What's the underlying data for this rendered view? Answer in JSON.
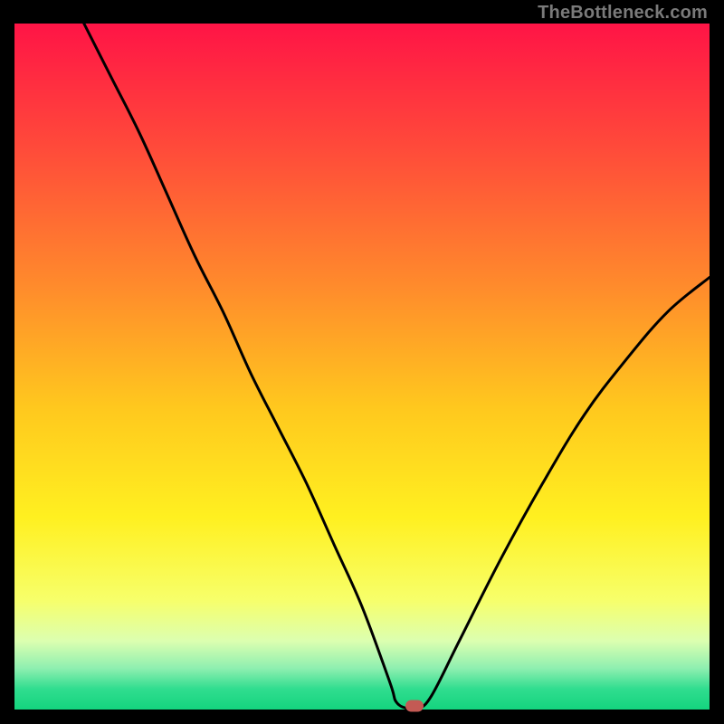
{
  "watermark": "TheBottleneck.com",
  "chart_data": {
    "type": "line",
    "title": "",
    "xlabel": "",
    "ylabel": "",
    "xlim": [
      0,
      100
    ],
    "ylim": [
      0,
      100
    ],
    "grid": false,
    "legend": false,
    "series": [
      {
        "name": "bottleneck-curve",
        "x": [
          10,
          14,
          18,
          22,
          26,
          30,
          34,
          38,
          42,
          46,
          50,
          54,
          55,
          57,
          58,
          60,
          64,
          70,
          76,
          82,
          88,
          94,
          100
        ],
        "y": [
          100,
          92,
          84,
          75,
          66,
          58,
          49,
          41,
          33,
          24,
          15,
          4,
          1,
          0,
          0,
          2,
          10,
          22,
          33,
          43,
          51,
          58,
          63
        ]
      }
    ],
    "marker": {
      "x": 57.5,
      "y": 0.5,
      "shape": "pill",
      "color": "#c35a54"
    },
    "background_gradient": {
      "stops": [
        {
          "offset": 0.0,
          "color": "#ff1446"
        },
        {
          "offset": 0.18,
          "color": "#ff4a3a"
        },
        {
          "offset": 0.38,
          "color": "#ff8a2c"
        },
        {
          "offset": 0.56,
          "color": "#ffc81e"
        },
        {
          "offset": 0.72,
          "color": "#fff020"
        },
        {
          "offset": 0.84,
          "color": "#f7ff6a"
        },
        {
          "offset": 0.9,
          "color": "#dcffb0"
        },
        {
          "offset": 0.94,
          "color": "#8eefb0"
        },
        {
          "offset": 0.97,
          "color": "#30dd8f"
        },
        {
          "offset": 1.0,
          "color": "#14d47e"
        }
      ]
    }
  }
}
